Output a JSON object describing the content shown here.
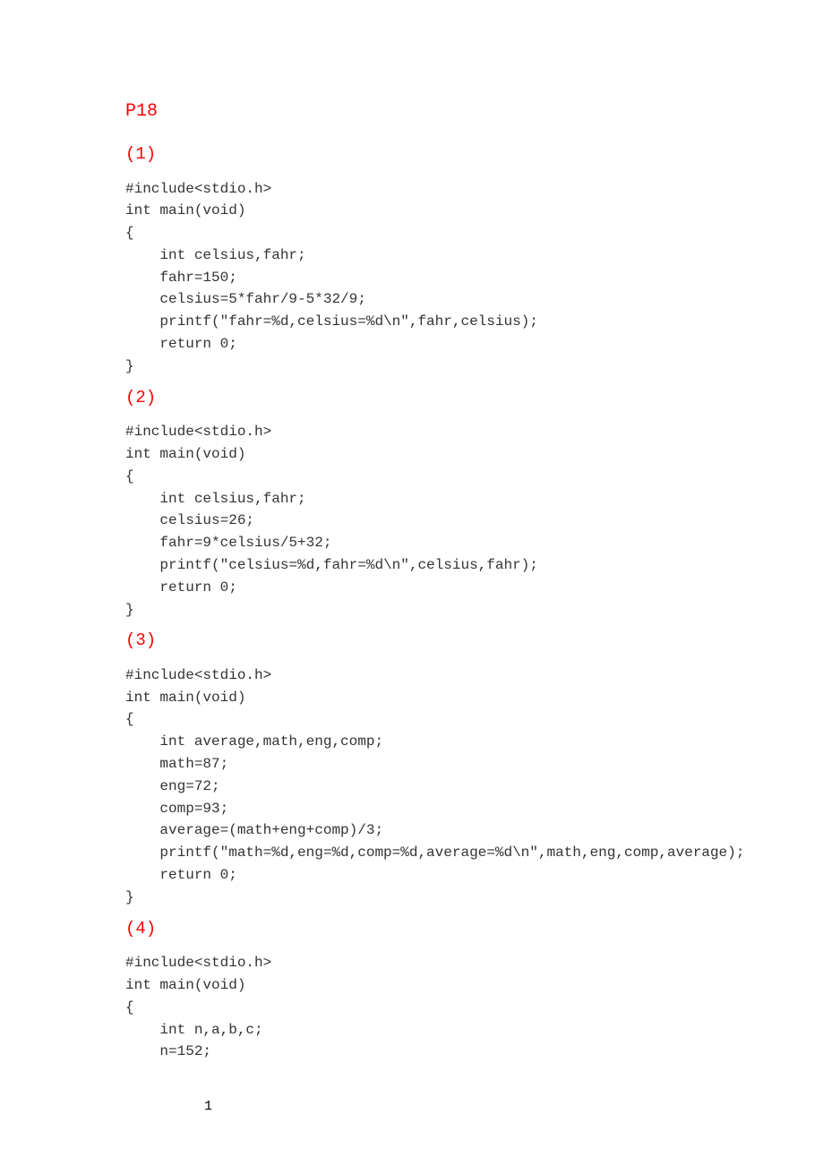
{
  "header": {
    "page_ref": "P18"
  },
  "sections": [
    {
      "label": "(1)",
      "code": "#include<stdio.h>\nint main(void)\n{\n    int celsius,fahr;\n    fahr=150;\n    celsius=5*fahr/9-5*32/9;\n    printf(\"fahr=%d,celsius=%d\\n\",fahr,celsius);\n    return 0;\n}"
    },
    {
      "label": "(2)",
      "code": "#include<stdio.h>\nint main(void)\n{\n    int celsius,fahr;\n    celsius=26;\n    fahr=9*celsius/5+32;\n    printf(\"celsius=%d,fahr=%d\\n\",celsius,fahr);\n    return 0;\n}"
    },
    {
      "label": "(3)",
      "code": "#include<stdio.h>\nint main(void)\n{\n    int average,math,eng,comp;\n    math=87;\n    eng=72;\n    comp=93;\n    average=(math+eng+comp)/3;\n    printf(\"math=%d,eng=%d,comp=%d,average=%d\\n\",math,eng,comp,average);\n    return 0;\n}"
    },
    {
      "label": "(4)",
      "code": "#include<stdio.h>\nint main(void)\n{\n    int n,a,b,c;\n    n=152;"
    }
  ],
  "footer": {
    "page_number": "1"
  }
}
